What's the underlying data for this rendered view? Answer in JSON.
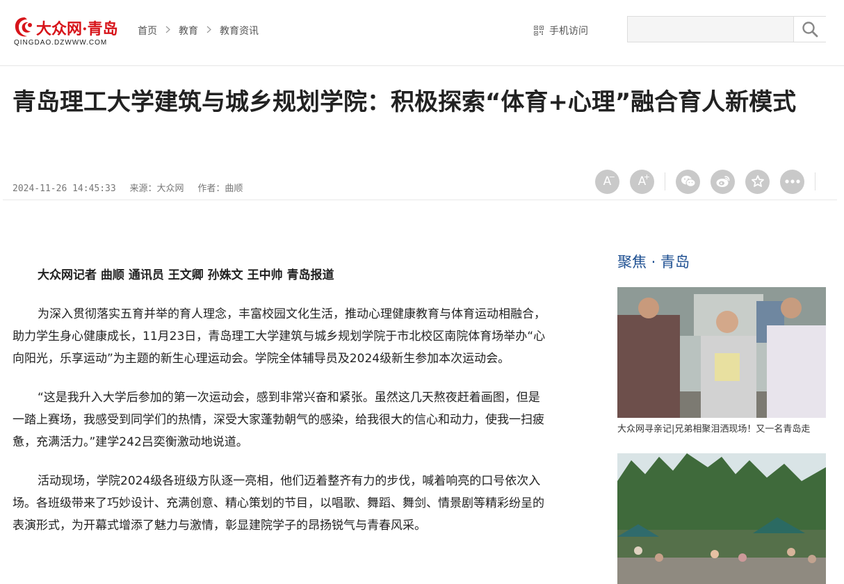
{
  "header": {
    "logo_title": "大众网·青岛",
    "logo_sub": "QINGDAO.DZWWW.COM",
    "breadcrumb": [
      "首页",
      "教育",
      "教育资讯"
    ],
    "mobile_label": "手机访问",
    "search_placeholder": ""
  },
  "article": {
    "title": "青岛理工大学建筑与城乡规划学院：积极探索“体育+心理”融合育人新模式",
    "datetime": "2024-11-26 14:45:33",
    "source": "来源：大众网",
    "author": "作者：曲顺",
    "paragraphs": [
      "大众网记者 曲顺 通讯员 王文卿 孙姝文 王中帅 青岛报道",
      "为深入贯彻落实五育并举的育人理念，丰富校园文化生活，推动心理健康教育与体育运动相融合，助力学生身心健康成长，11月23日，青岛理工大学建筑与城乡规划学院于市北校区南院体育场举办“心向阳光，乐享运动”为主题的新生心理运动会。学院全体辅导员及2024级新生参加本次运动会。",
      "“这是我升入大学后参加的第一次运动会，感到非常兴奋和紧张。虽然这几天熬夜赶着画图，但是一踏上赛场，我感受到同学们的热情，深受大家蓬勃朝气的感染，给我很大的信心和动力，使我一扫疲惫，充满活力。”建学242吕奕衡激动地说道。",
      "活动现场，学院2024级各班级方队逐一亮相，他们迈着整齐有力的步伐，喊着响亮的口号依次入场。各班级带来了巧妙设计、充满创意、精心策划的节目，以唱歌、舞蹈、舞剑、情景剧等精彩纷呈的表演形式，为开幕式增添了魅力与激情，彰显建院学子的昂扬锐气与青春风采。"
    ]
  },
  "tools": [
    {
      "name": "font-decrease",
      "glyph": "A",
      "sup": "−"
    },
    {
      "name": "font-increase",
      "glyph": "A",
      "sup": "+"
    },
    {
      "name": "wechat-share",
      "glyph": "💬"
    },
    {
      "name": "weibo-share",
      "glyph": "◉"
    },
    {
      "name": "favorite",
      "glyph": "☆"
    },
    {
      "name": "more",
      "glyph": "•••"
    }
  ],
  "sidebar": {
    "title": "聚焦 · 青岛",
    "cards": [
      {
        "caption": "大众网寻亲记|兄弟相聚泪洒现场！又一名青岛走"
      },
      {
        "caption": ""
      }
    ]
  },
  "colors": {
    "brand_red": "#d7141a",
    "sidebar_blue": "#1d4f91",
    "icon_gray": "#c9c9c9"
  }
}
